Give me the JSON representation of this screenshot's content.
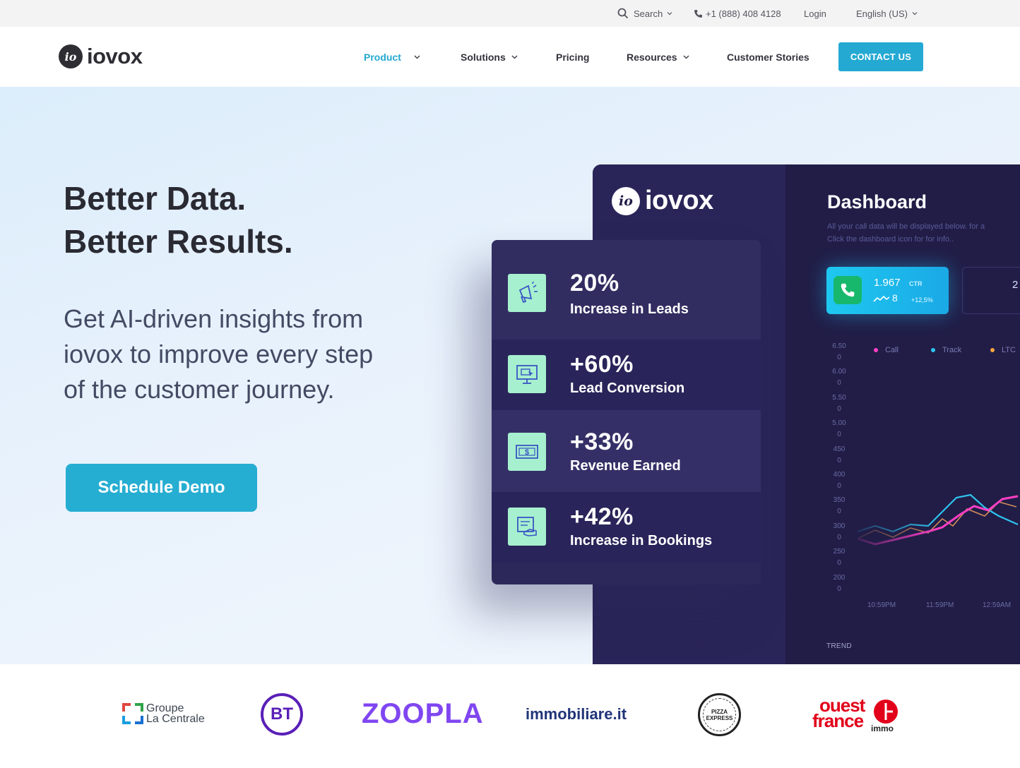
{
  "topbar": {
    "search_label": "Search",
    "phone": "+1 (888) 408 4128",
    "login": "Login",
    "language": "English (US)"
  },
  "nav": {
    "logo_text": "iovox",
    "logo_badge": "io",
    "items": [
      {
        "label": "Product",
        "active": true
      },
      {
        "label": "Solutions"
      },
      {
        "label": "Pricing"
      },
      {
        "label": "Resources"
      },
      {
        "label": "Customer Stories"
      }
    ],
    "contact_label": "CONTACT US"
  },
  "hero": {
    "title_line1": "Better Data.",
    "title_line2": "Better Results.",
    "subtitle_line1": "Get AI-driven insights from",
    "subtitle_line2": "iovox to improve every step",
    "subtitle_line3": "of the customer journey.",
    "cta": "Schedule Demo"
  },
  "dashboard": {
    "logo_text": "iovox",
    "logo_badge": "io",
    "title": "Dashboard",
    "desc_line1": "All your call data will be displayed below. for a",
    "desc_line2": "Click the dashboard icon for for info..",
    "ctr_value": "1.967",
    "ctr_label": "CTR",
    "ctr_spark_label": "8",
    "ctr_change": "+12,5%",
    "card2_value": "2",
    "legend": [
      {
        "label": "Call",
        "color": "#ff3fc5"
      },
      {
        "label": "Track",
        "color": "#2ec5ef"
      },
      {
        "label": "LTC",
        "color": "#f5a43c"
      }
    ],
    "y_ticks": [
      [
        "6.50",
        "0"
      ],
      [
        "6.00",
        "0"
      ],
      [
        "5.50",
        "0"
      ],
      [
        "5.00",
        "0"
      ],
      [
        "450",
        "0"
      ],
      [
        "400",
        "0"
      ],
      [
        "350",
        "0"
      ],
      [
        "300",
        "0"
      ],
      [
        "250",
        "0"
      ],
      [
        "200",
        "0"
      ]
    ],
    "x_ticks": [
      "10:59PM",
      "11:59PM",
      "12:59AM"
    ],
    "trend_label": "TREND",
    "line_colors": {
      "call": "#ff3fc5",
      "track": "#2ec5ef",
      "ltc": "#d08a5a"
    }
  },
  "stats": [
    {
      "value": "20%",
      "label": "Increase in Leads",
      "icon": "megaphone-icon"
    },
    {
      "value": "+60%",
      "label": "Lead Conversion",
      "icon": "monitor-cursor-icon"
    },
    {
      "value": "+33%",
      "label": "Revenue Earned",
      "icon": "dollar-bill-icon"
    },
    {
      "value": "+42%",
      "label": "Increase in Bookings",
      "icon": "calendar-hand-icon"
    }
  ],
  "logos": {
    "groupe_line1": "Groupe",
    "groupe_line2": "La Centrale",
    "bt": "BT",
    "zoopla": "ZOOPLA",
    "immobiliare": "immobiliare.it",
    "pizza_line1": "PIZZA",
    "pizza_line2": "EXPRESS",
    "ouest_line1": "ouest",
    "ouest_line2": "france",
    "ouest_line3": "immo"
  },
  "colors": {
    "accent": "#24a9d3",
    "dashboard_bg": "#211d47",
    "stat_icon_bg": "#a7f0cf"
  }
}
